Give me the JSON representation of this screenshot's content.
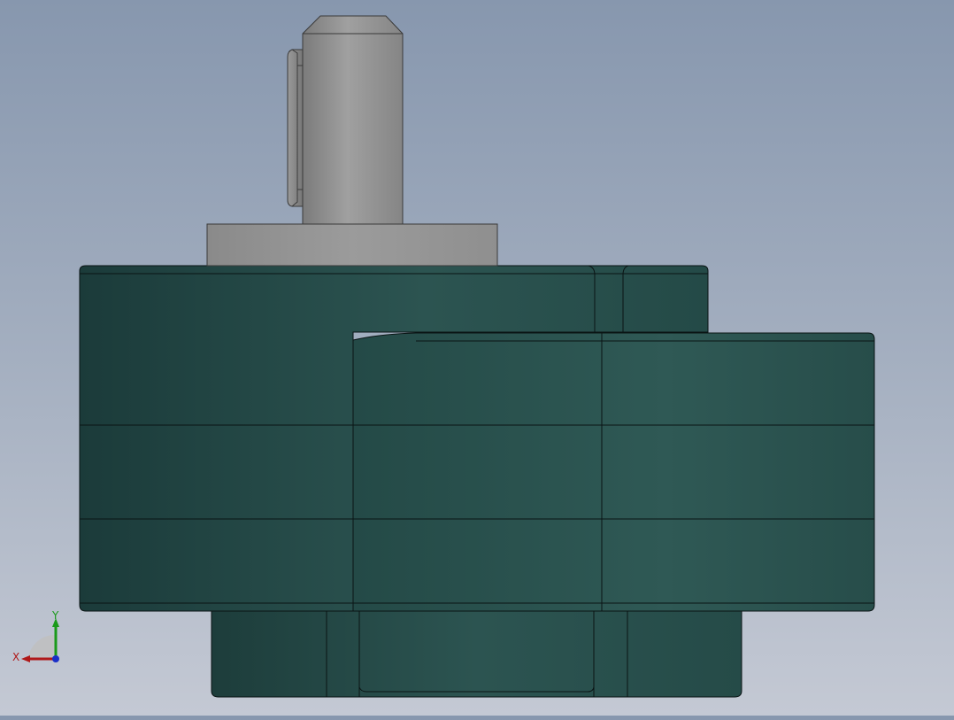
{
  "viewport": {
    "background_top": "#8797ae",
    "background_bottom": "#c4c9d4"
  },
  "model": {
    "housing_color": "#244a47",
    "housing_dark": "#1c3c3a",
    "housing_light": "#2e5753",
    "edge_color": "#0a1414",
    "shaft_color": "#8c8c8c",
    "shaft_light": "#a3a3a3"
  },
  "triad": {
    "x_label": "X",
    "y_label": "Y",
    "x_color": "#b01818",
    "y_color": "#1a9a1a",
    "z_color": "#1a2fc8"
  }
}
